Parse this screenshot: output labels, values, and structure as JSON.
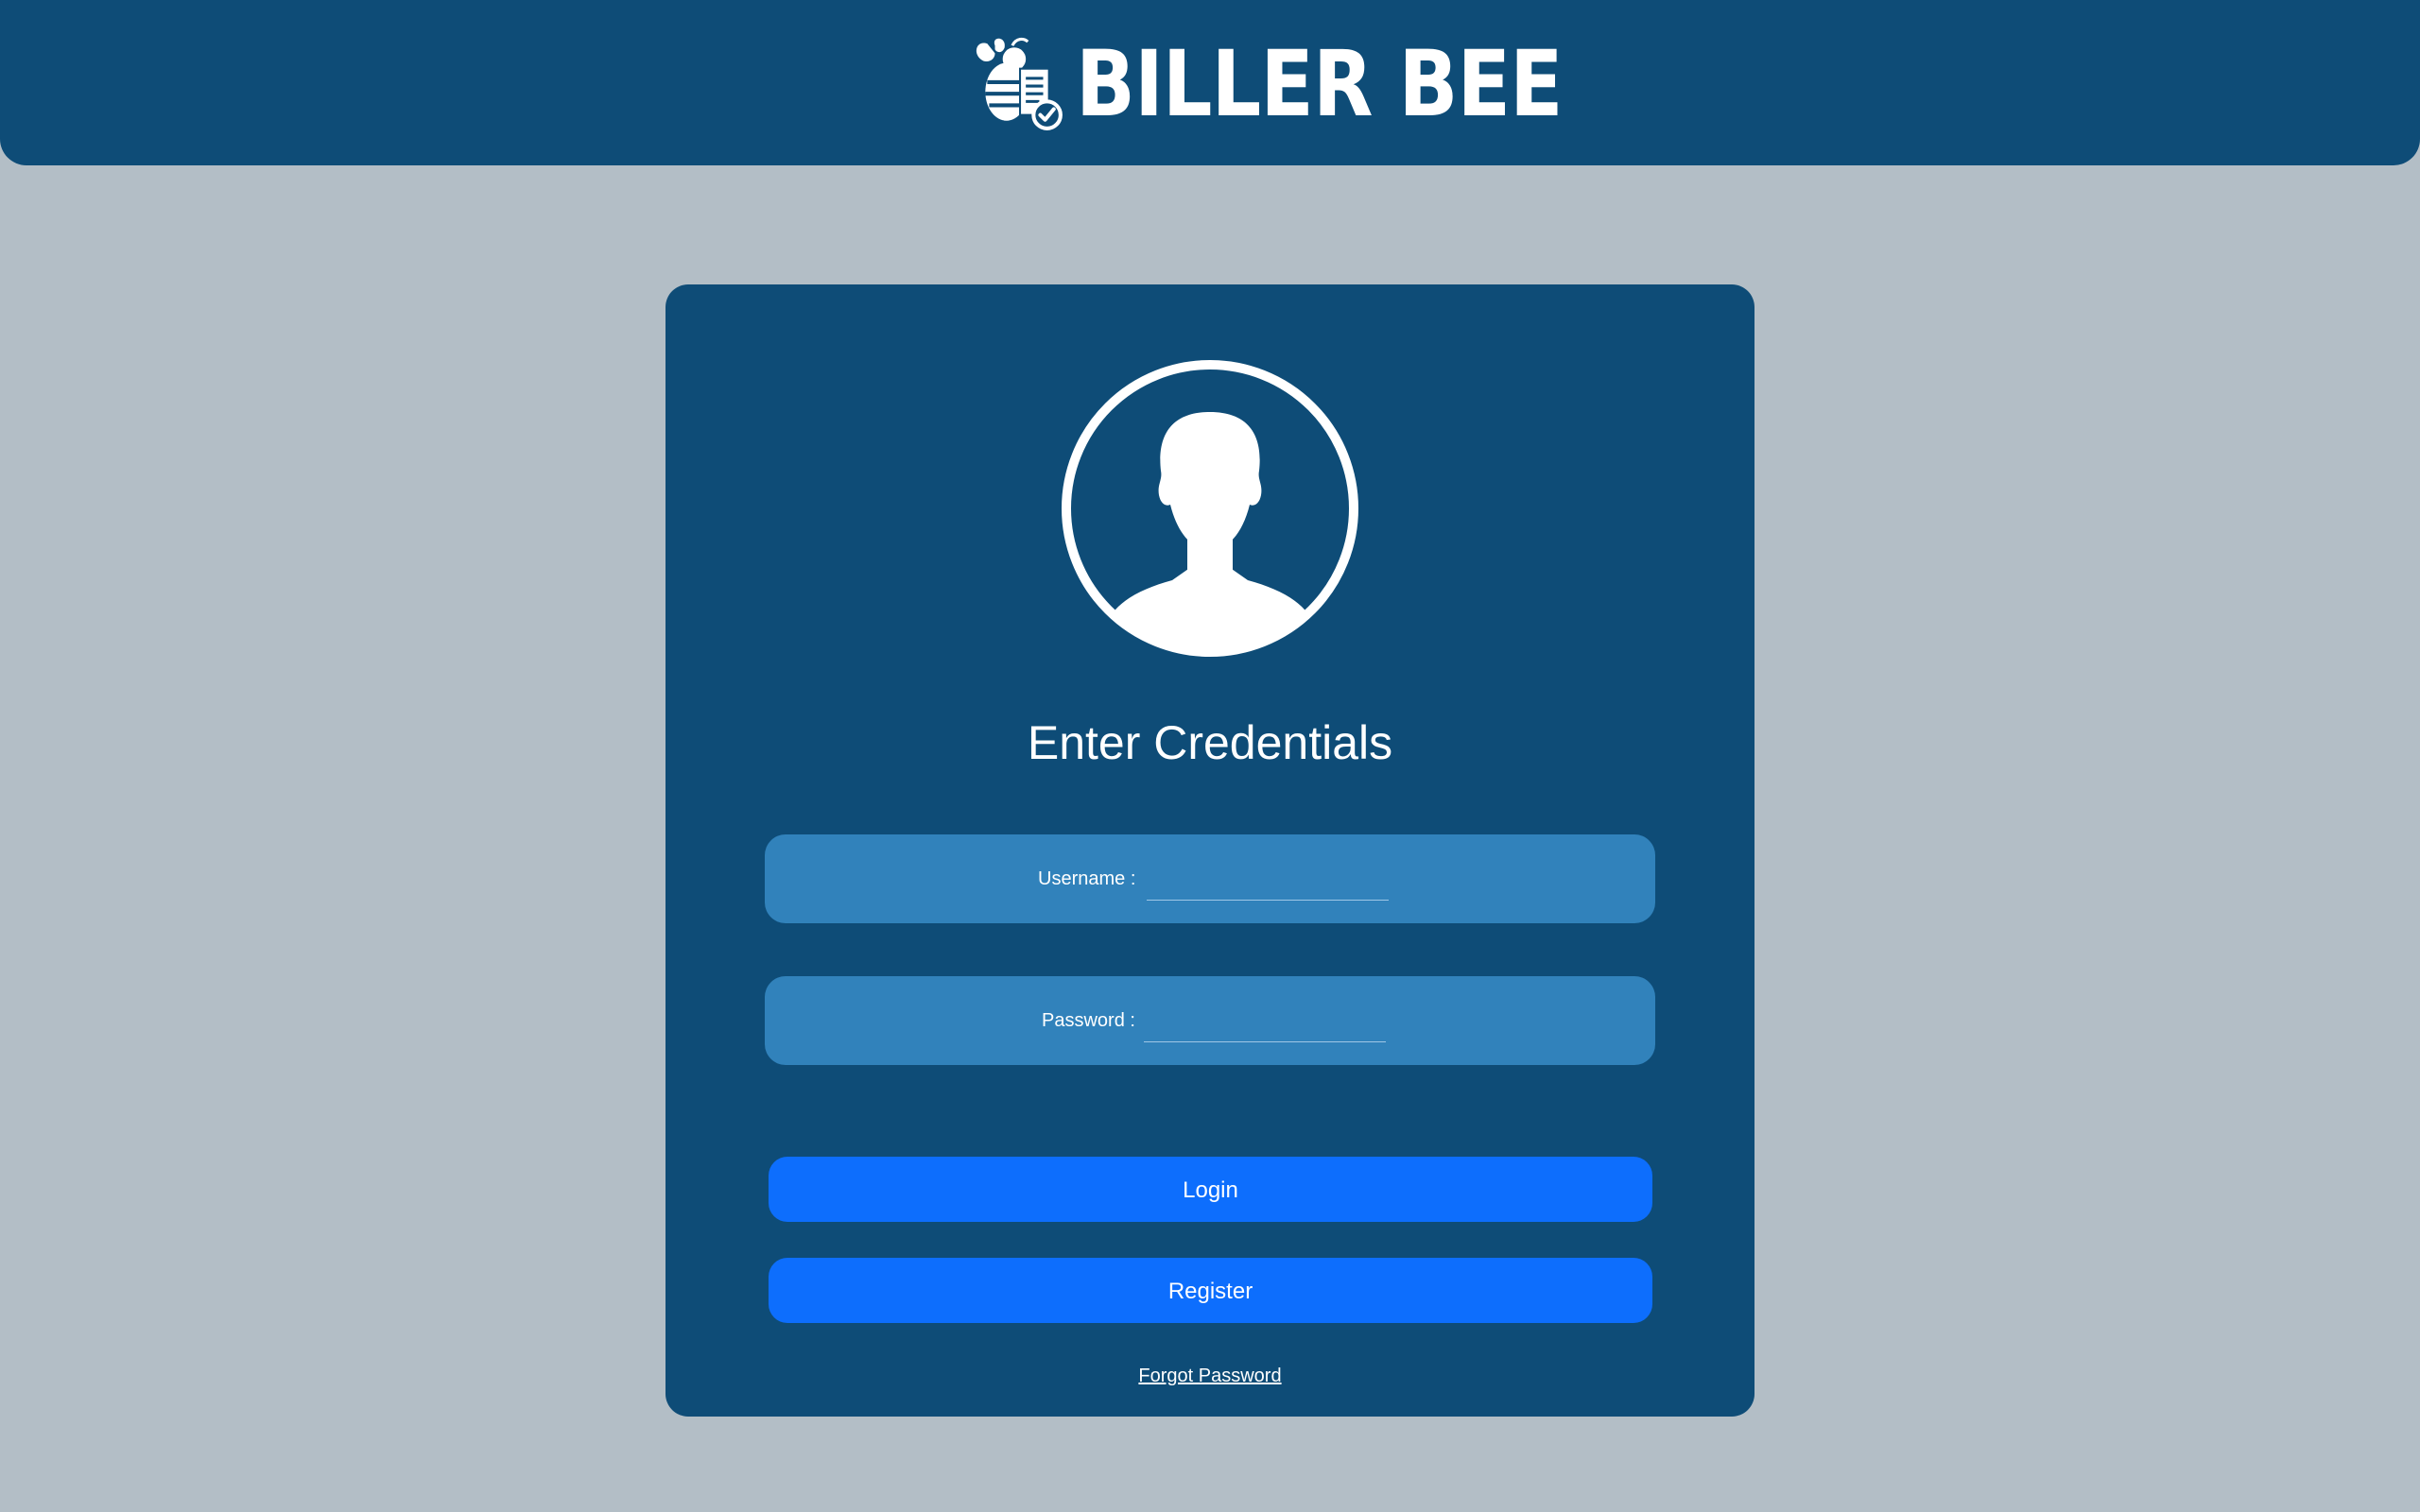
{
  "header": {
    "brand_name": "BILLER BEE",
    "logo_icon": "bee-invoice-check-icon",
    "background_color": "#0e4c77"
  },
  "login_card": {
    "avatar_icon": "user-silhouette-icon",
    "title": "Enter Credentials",
    "username_label": "Username :",
    "username_value": "",
    "password_label": "Password :",
    "password_value": "",
    "login_label": "Login",
    "register_label": "Register",
    "forgot_password_label": "Forgot Password"
  },
  "colors": {
    "page_background": "#b3bec6",
    "card_background": "#0e4c77",
    "field_background": "#3182bb",
    "button_primary": "#0d6efd"
  }
}
